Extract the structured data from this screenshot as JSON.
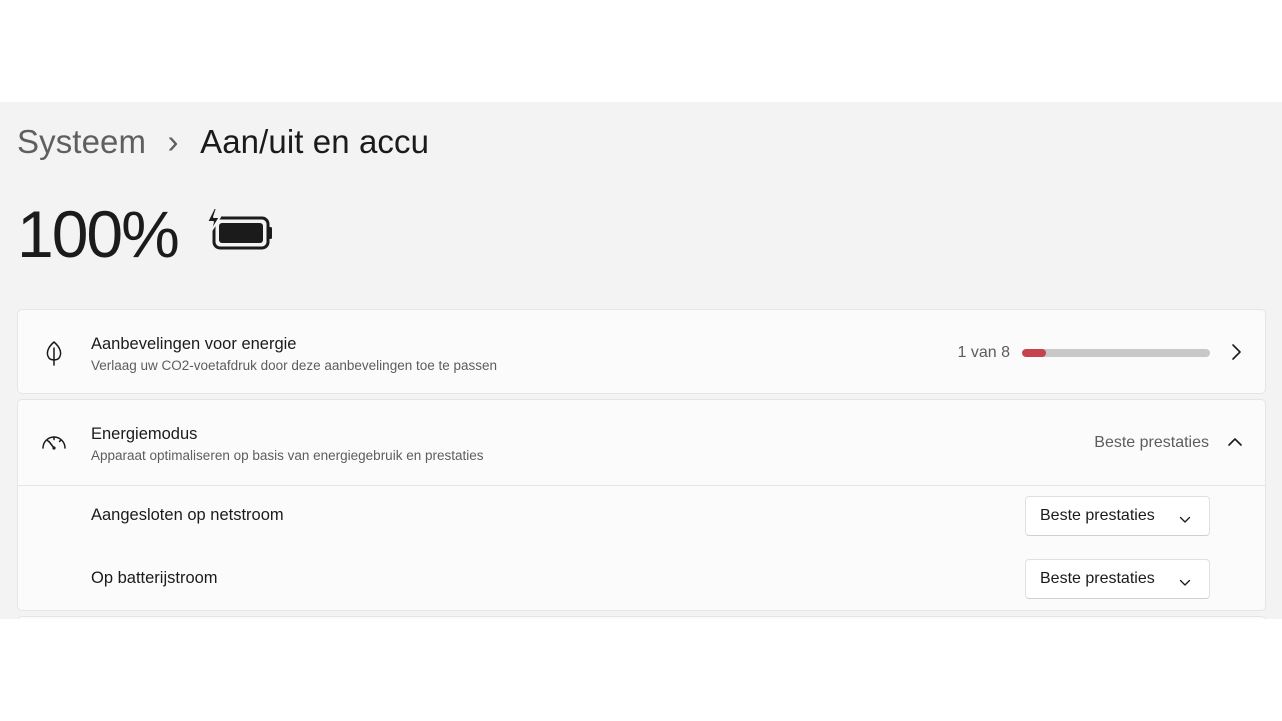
{
  "breadcrumb": {
    "parent": "Systeem",
    "separator": "›",
    "current": "Aan/uit en accu"
  },
  "battery": {
    "percentage_label": "100%",
    "percentage": 100,
    "charging": true,
    "icon": "battery-charging-icon"
  },
  "recommendations": {
    "icon": "leaf-icon",
    "title": "Aanbevelingen voor energie",
    "subtitle": "Verlaag uw CO2-voetafdruk door deze aanbevelingen toe te passen",
    "count_label": "1 van 8",
    "progress_fraction": 0.125,
    "progress_color": "#c4434d"
  },
  "power_mode": {
    "icon": "gauge-icon",
    "title": "Energiemodus",
    "subtitle": "Apparaat optimaliseren op basis van energiegebruik en prestaties",
    "value": "Beste prestaties",
    "expanded": true,
    "rows": [
      {
        "label": "Aangesloten op netstroom",
        "selected": "Beste prestaties"
      },
      {
        "label": "Op batterijstroom",
        "selected": "Beste prestaties"
      }
    ]
  },
  "colors": {
    "background": "#f3f3f3",
    "card": "#fbfbfb",
    "accent_progress": "#c4434d"
  }
}
